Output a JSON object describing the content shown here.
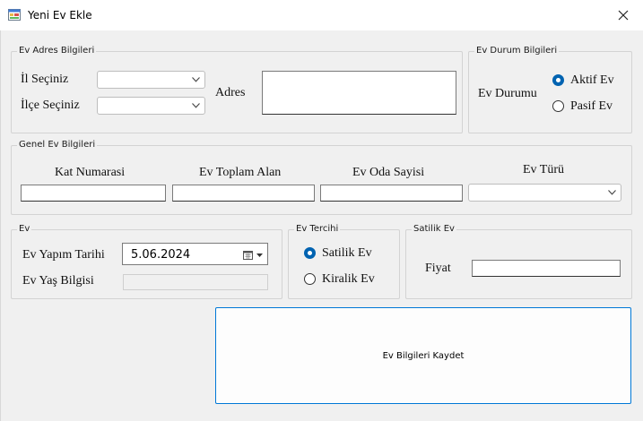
{
  "window": {
    "title": "Yeni Ev Ekle",
    "close_icon": "close-icon",
    "app_icon": "form-icon"
  },
  "address_group": {
    "title": "Ev Adres Bilgileri",
    "il_label": "İl Seçiniz",
    "il_value": "",
    "ilce_label": "İlçe Seçiniz",
    "ilce_value": "",
    "adres_label": "Adres",
    "adres_value": ""
  },
  "status_group": {
    "title": "Ev Durum Bilgileri",
    "label": "Ev Durumu",
    "options": [
      {
        "label": "Aktif Ev",
        "checked": true
      },
      {
        "label": "Pasif Ev",
        "checked": false
      }
    ]
  },
  "general_group": {
    "title": "Genel Ev Bilgileri",
    "kat_label": "Kat Numarasi",
    "kat_value": "",
    "alan_label": "Ev Toplam Alan",
    "alan_value": "",
    "oda_label": "Ev Oda Sayisi",
    "oda_value": "",
    "tur_label": "Ev Türü",
    "tur_value": ""
  },
  "ev_group": {
    "title": "Ev",
    "yapim_label": "Ev Yapım Tarihi",
    "yapim_value": "5.06.2024",
    "yas_label": "Ev Yaş Bilgisi",
    "yas_value": ""
  },
  "tercih_group": {
    "title": "Ev Tercihi",
    "options": [
      {
        "label": "Satilik Ev",
        "checked": true
      },
      {
        "label": "Kiralik Ev",
        "checked": false
      }
    ]
  },
  "satilik_group": {
    "title": "Satilik Ev",
    "fiyat_label": "Fiyat",
    "fiyat_value": ""
  },
  "save_button": {
    "label": "Ev Bilgileri Kaydet"
  },
  "colors": {
    "accent": "#0078d7",
    "radio_checked": "#0063b1",
    "background": "#f0f0f0"
  }
}
